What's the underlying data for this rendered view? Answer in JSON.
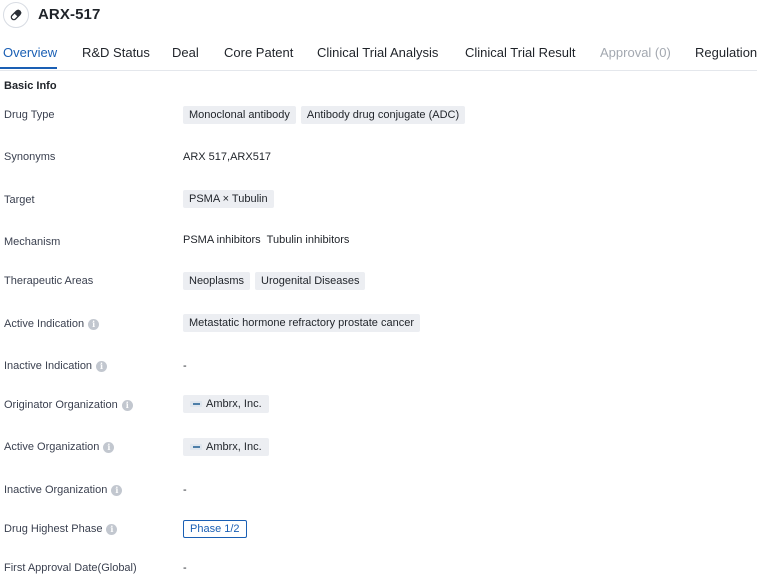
{
  "header": {
    "title": "ARX-517",
    "icon": "pill-icon"
  },
  "tabs": [
    {
      "label": "Overview",
      "state": "active"
    },
    {
      "label": "R&D Status",
      "state": "normal"
    },
    {
      "label": "Deal",
      "state": "normal"
    },
    {
      "label": "Core Patent",
      "state": "normal"
    },
    {
      "label": "Clinical Trial Analysis",
      "state": "normal"
    },
    {
      "label": "Clinical Trial Result",
      "state": "normal"
    },
    {
      "label": "Approval (0)",
      "state": "disabled"
    },
    {
      "label": "Regulation",
      "state": "normal"
    }
  ],
  "basic_info": {
    "section_title": "Basic Info",
    "drug_type": {
      "label": "Drug Type",
      "tags": [
        "Monoclonal antibody",
        "Antibody drug conjugate (ADC)"
      ]
    },
    "synonyms": {
      "label": "Synonyms",
      "value": "ARX 517,ARX517"
    },
    "target": {
      "label": "Target",
      "tags": [
        "PSMA × Tubulin"
      ]
    },
    "mechanism": {
      "label": "Mechanism",
      "items": [
        "PSMA inhibitors",
        "Tubulin inhibitors"
      ]
    },
    "therapeutic_areas": {
      "label": "Therapeutic Areas",
      "tags": [
        "Neoplasms",
        "Urogenital Diseases"
      ]
    },
    "active_indication": {
      "label": "Active Indication",
      "tags": [
        "Metastatic hormone refractory prostate cancer"
      ]
    },
    "inactive_indication": {
      "label": "Inactive Indication",
      "value": "-"
    },
    "originator_organization": {
      "label": "Originator Organization",
      "org": "Ambrx, Inc."
    },
    "active_organization": {
      "label": "Active Organization",
      "org": "Ambrx, Inc."
    },
    "inactive_organization": {
      "label": "Inactive Organization",
      "value": "-"
    },
    "drug_highest_phase": {
      "label": "Drug Highest Phase",
      "value": "Phase 1/2"
    },
    "first_approval_date": {
      "label": "First Approval Date(Global)",
      "value": "-"
    }
  },
  "colors": {
    "accent": "#1a5fb4",
    "tag_bg": "#eceef2",
    "disabled_tab": "#a3a8b0"
  }
}
